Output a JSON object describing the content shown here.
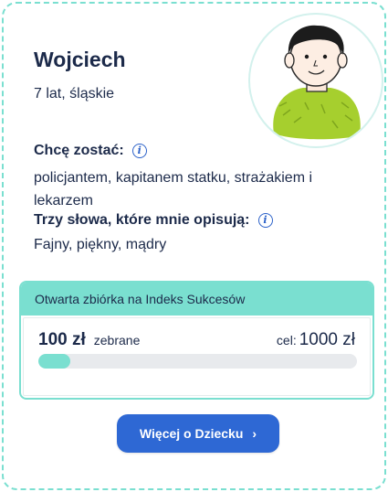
{
  "child": {
    "name": "Wojciech",
    "meta": "7 lat, śląskie"
  },
  "dream": {
    "heading": "Chcę zostać:",
    "text": "policjantem, kapitanem statku, strażakiem i lekarzem"
  },
  "words": {
    "heading": "Trzy słowa, które mnie opisują:",
    "text": "Fajny, piękny, mądry"
  },
  "fundraiser": {
    "title": "Otwarta zbiórka na Indeks Sukcesów",
    "raised_amount": "100 zł",
    "raised_label": "zebrane",
    "goal_label": "cel:",
    "goal_amount": "1000 zł",
    "progress_fraction": 0.1
  },
  "cta": {
    "label": "Więcej o Dziecku",
    "chevron": "›"
  },
  "colors": {
    "accent_teal": "#7adfd0",
    "primary_blue": "#2e68d4",
    "text_navy": "#1c2a4a"
  },
  "icons": {
    "info": "info-icon",
    "chevron": "chevron-right-icon",
    "avatar": "child-drawing-avatar"
  }
}
